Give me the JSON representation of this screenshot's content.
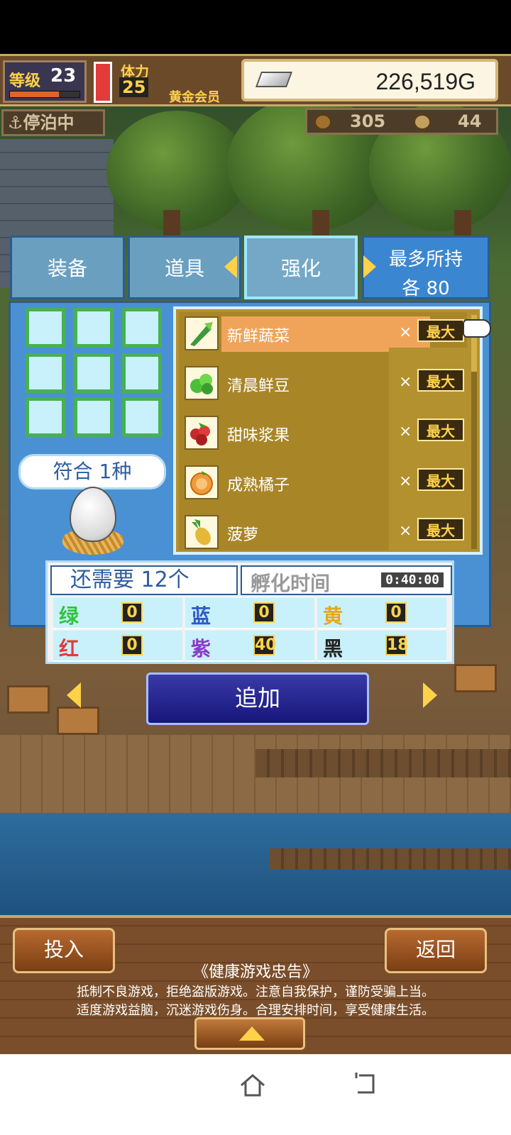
{
  "hud": {
    "level_label": "等级",
    "level": "23",
    "level_progress": 0.7,
    "stamina_label": "体力",
    "stamina": "25",
    "membership": "黄金会员",
    "gold": "226,519G"
  },
  "status": {
    "docked": "停泊中",
    "resource1": "305",
    "resource2": "44"
  },
  "tabs": [
    {
      "label": "装备"
    },
    {
      "label": "道具"
    },
    {
      "label": "强化"
    }
  ],
  "max_hold": {
    "line1": "最多所持",
    "line2": "各 80"
  },
  "match": "符合 1种",
  "items": [
    {
      "name": "新鲜蔬菜",
      "x": "×",
      "qty": "最大",
      "icon": "vegetable-icon"
    },
    {
      "name": "清晨鲜豆",
      "x": "×",
      "qty": "最大",
      "icon": "bean-icon"
    },
    {
      "name": "甜味浆果",
      "x": "×",
      "qty": "最大",
      "icon": "berry-icon"
    },
    {
      "name": "成熟橘子",
      "x": "×",
      "qty": "最大",
      "icon": "orange-icon"
    },
    {
      "name": "菠萝",
      "x": "×",
      "qty": "最大",
      "icon": "pineapple-icon"
    }
  ],
  "needs": "还需要 12个",
  "hatch": {
    "label": "孵化时间",
    "time": "0:40:00"
  },
  "counts": [
    {
      "label": "绿",
      "value": "0",
      "color": "#2fc43a"
    },
    {
      "label": "蓝",
      "value": "0",
      "color": "#2e58c8"
    },
    {
      "label": "黄",
      "value": "0",
      "color": "#e6a81a"
    },
    {
      "label": "红",
      "value": "0",
      "color": "#e23a3a"
    },
    {
      "label": "紫",
      "value": "40",
      "color": "#8a3ac8"
    },
    {
      "label": "黑",
      "value": "18",
      "color": "#222222"
    }
  ],
  "add_button": "追加",
  "bottom": {
    "put_in": "投入",
    "back": "返回",
    "health_title": "《健康游戏忠告》",
    "health_line1": "抵制不良游戏，拒绝盗版游戏。注意自我保护，谨防受骗上当。",
    "health_line2": "适度游戏益脑，沉迷游戏伤身。合理安排时间，享受健康生活。"
  }
}
